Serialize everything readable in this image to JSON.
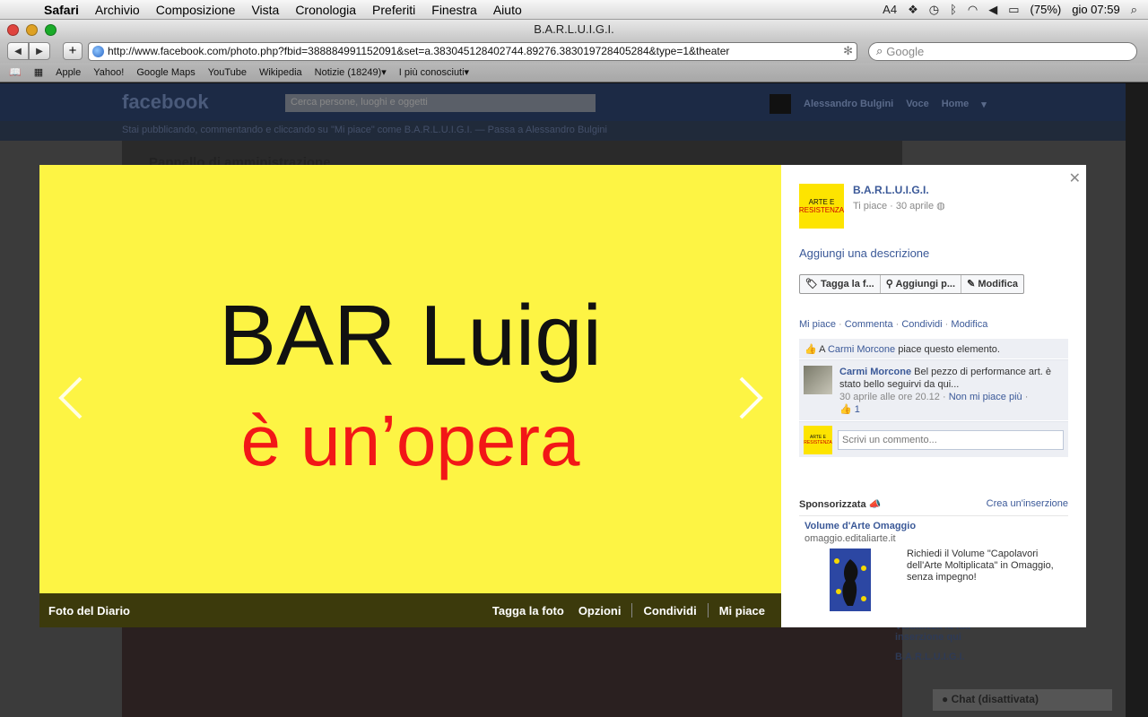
{
  "menubar": {
    "app": "Safari",
    "items": [
      "Archivio",
      "Composizione",
      "Vista",
      "Cronologia",
      "Preferiti",
      "Finestra",
      "Aiuto"
    ],
    "status": {
      "flag_count": "4",
      "battery": "(75%)",
      "clock": "gio 07:59"
    }
  },
  "window": {
    "title": "B.A.R.L.U.I.G.I."
  },
  "toolbar": {
    "url": "http://www.facebook.com/photo.php?fbid=388884991152091&set=a.383045128402744.89276.383019728405284&type=1&theater",
    "search_placeholder": "Google"
  },
  "bookmarks": [
    "Apple",
    "Yahoo!",
    "Google Maps",
    "YouTube",
    "Wikipedia",
    "Notizie (18249)▾",
    "I più conosciuti▾"
  ],
  "background_page": {
    "logo": "facebook",
    "search_placeholder": "Cerca persone, luoghi e oggetti",
    "user_name": "Alessandro Bulgini",
    "nav": [
      "Voce",
      "Home"
    ],
    "notice": "Stai pubblicando, commentando e cliccando su \"Mi piace\" come B.A.R.L.U.I.G.I. — Passa a Alessandro Bulgini",
    "admin_title": "Pannello di amministrazione",
    "side_text_1": "Visualizza la tua inserzione qui",
    "side_text_2": "B.A.R.L.U.I.G.I.",
    "chat": "Chat (disattivata)"
  },
  "photo": {
    "line1": "BAR Luigi",
    "line2": "è un’opera",
    "bg_color": "#fdf444",
    "line2_color": "#f21717"
  },
  "photo_bar": {
    "album": "Foto del Diario",
    "actions": [
      "Tagga la foto",
      "Opzioni",
      "Condividi",
      "Mi piace"
    ]
  },
  "sidebar": {
    "page_name": "B.A.R.L.U.I.G.I.",
    "page_thumb_line1": "ARTE E",
    "page_thumb_line2": "RESISTENZA",
    "meta": "Ti piace · 30 aprile",
    "add_description": "Aggiungi una descrizione",
    "buttons": [
      "Tagga la f...",
      "Aggiungi p...",
      "Modifica"
    ],
    "actions": [
      "Mi piace",
      "Commenta",
      "Condividi",
      "Modifica"
    ],
    "like_prefix": "A",
    "like_user": "Carmi Morcone",
    "like_suffix": "piace questo elemento.",
    "comment": {
      "author": "Carmi Morcone",
      "text": "Bel pezzo di performance art. è stato bello seguirvi da qui...",
      "date": "30 aprile alle ore 20.12",
      "unlike": "Non mi piace più",
      "likes": "1"
    },
    "write_placeholder": "Scrivi un commento...",
    "sponsored": "Sponsorizzata",
    "create_ad": "Crea un'inserzione",
    "ad": {
      "title": "Volume d'Arte Omaggio",
      "url": "omaggio.editaliarte.it",
      "text": "Richiedi il Volume \"Capolavori dell'Arte Moltiplicata\" in Omaggio, senza impegno!"
    }
  }
}
